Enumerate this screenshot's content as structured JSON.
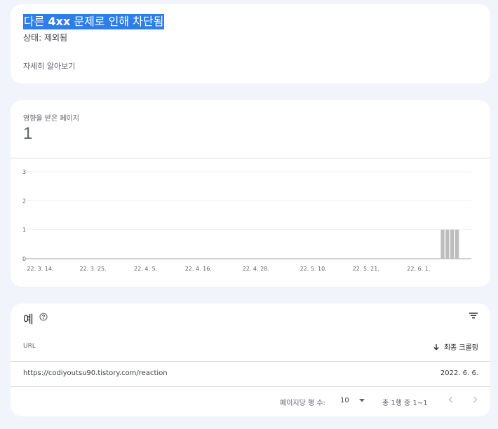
{
  "status_card": {
    "title_prefix": "다른 ",
    "title_bold": "4xx",
    "title_suffix": " 문제로 인해 차단됨",
    "status": "상태: 제외됨",
    "learn_more": "자세히 알아보기"
  },
  "metric": {
    "label": "영향을 받은 페이지",
    "value": "1"
  },
  "chart_data": {
    "type": "bar",
    "y_ticks": [
      "0",
      "1",
      "2",
      "3"
    ],
    "ylim": [
      0,
      3
    ],
    "grid": true,
    "x_tick_labels": [
      "22. 3. 14.",
      "22. 3. 25.",
      "22. 4. 5.",
      "22. 4. 16.",
      "22. 4. 28.",
      "22. 5. 10.",
      "22. 5. 21.",
      "22. 6. 1."
    ],
    "x_tick_dates": [
      "2022-03-14",
      "2022-03-25",
      "2022-04-05",
      "2022-04-16",
      "2022-04-28",
      "2022-05-10",
      "2022-05-21",
      "2022-06-01"
    ],
    "x_range": [
      "2022-03-11",
      "2022-06-12"
    ],
    "bars": [
      {
        "x": "2022-06-06",
        "value": 1
      },
      {
        "x": "2022-06-07",
        "value": 1
      },
      {
        "x": "2022-06-08",
        "value": 1
      },
      {
        "x": "2022-06-09",
        "value": 1
      }
    ],
    "bar_color": "#bdbdbd"
  },
  "examples": {
    "title": "예",
    "help_icon": "help-circle-icon",
    "filter_icon": "filter-icon",
    "columns": {
      "url": "URL",
      "crawl": "최종 크롤링"
    },
    "rows": [
      {
        "url": "https://codiyoutsu90.tistory.com/reaction",
        "date": "2022. 6. 6."
      }
    ],
    "pager": {
      "rows_per_page_label": "페이지당 행 수:",
      "rows_per_page": "10",
      "range": "총 1행 중 1~1"
    }
  },
  "colors": {
    "background": "#f1f4fb",
    "highlight": "#2f7de9",
    "bar": "#bdbdbd"
  }
}
